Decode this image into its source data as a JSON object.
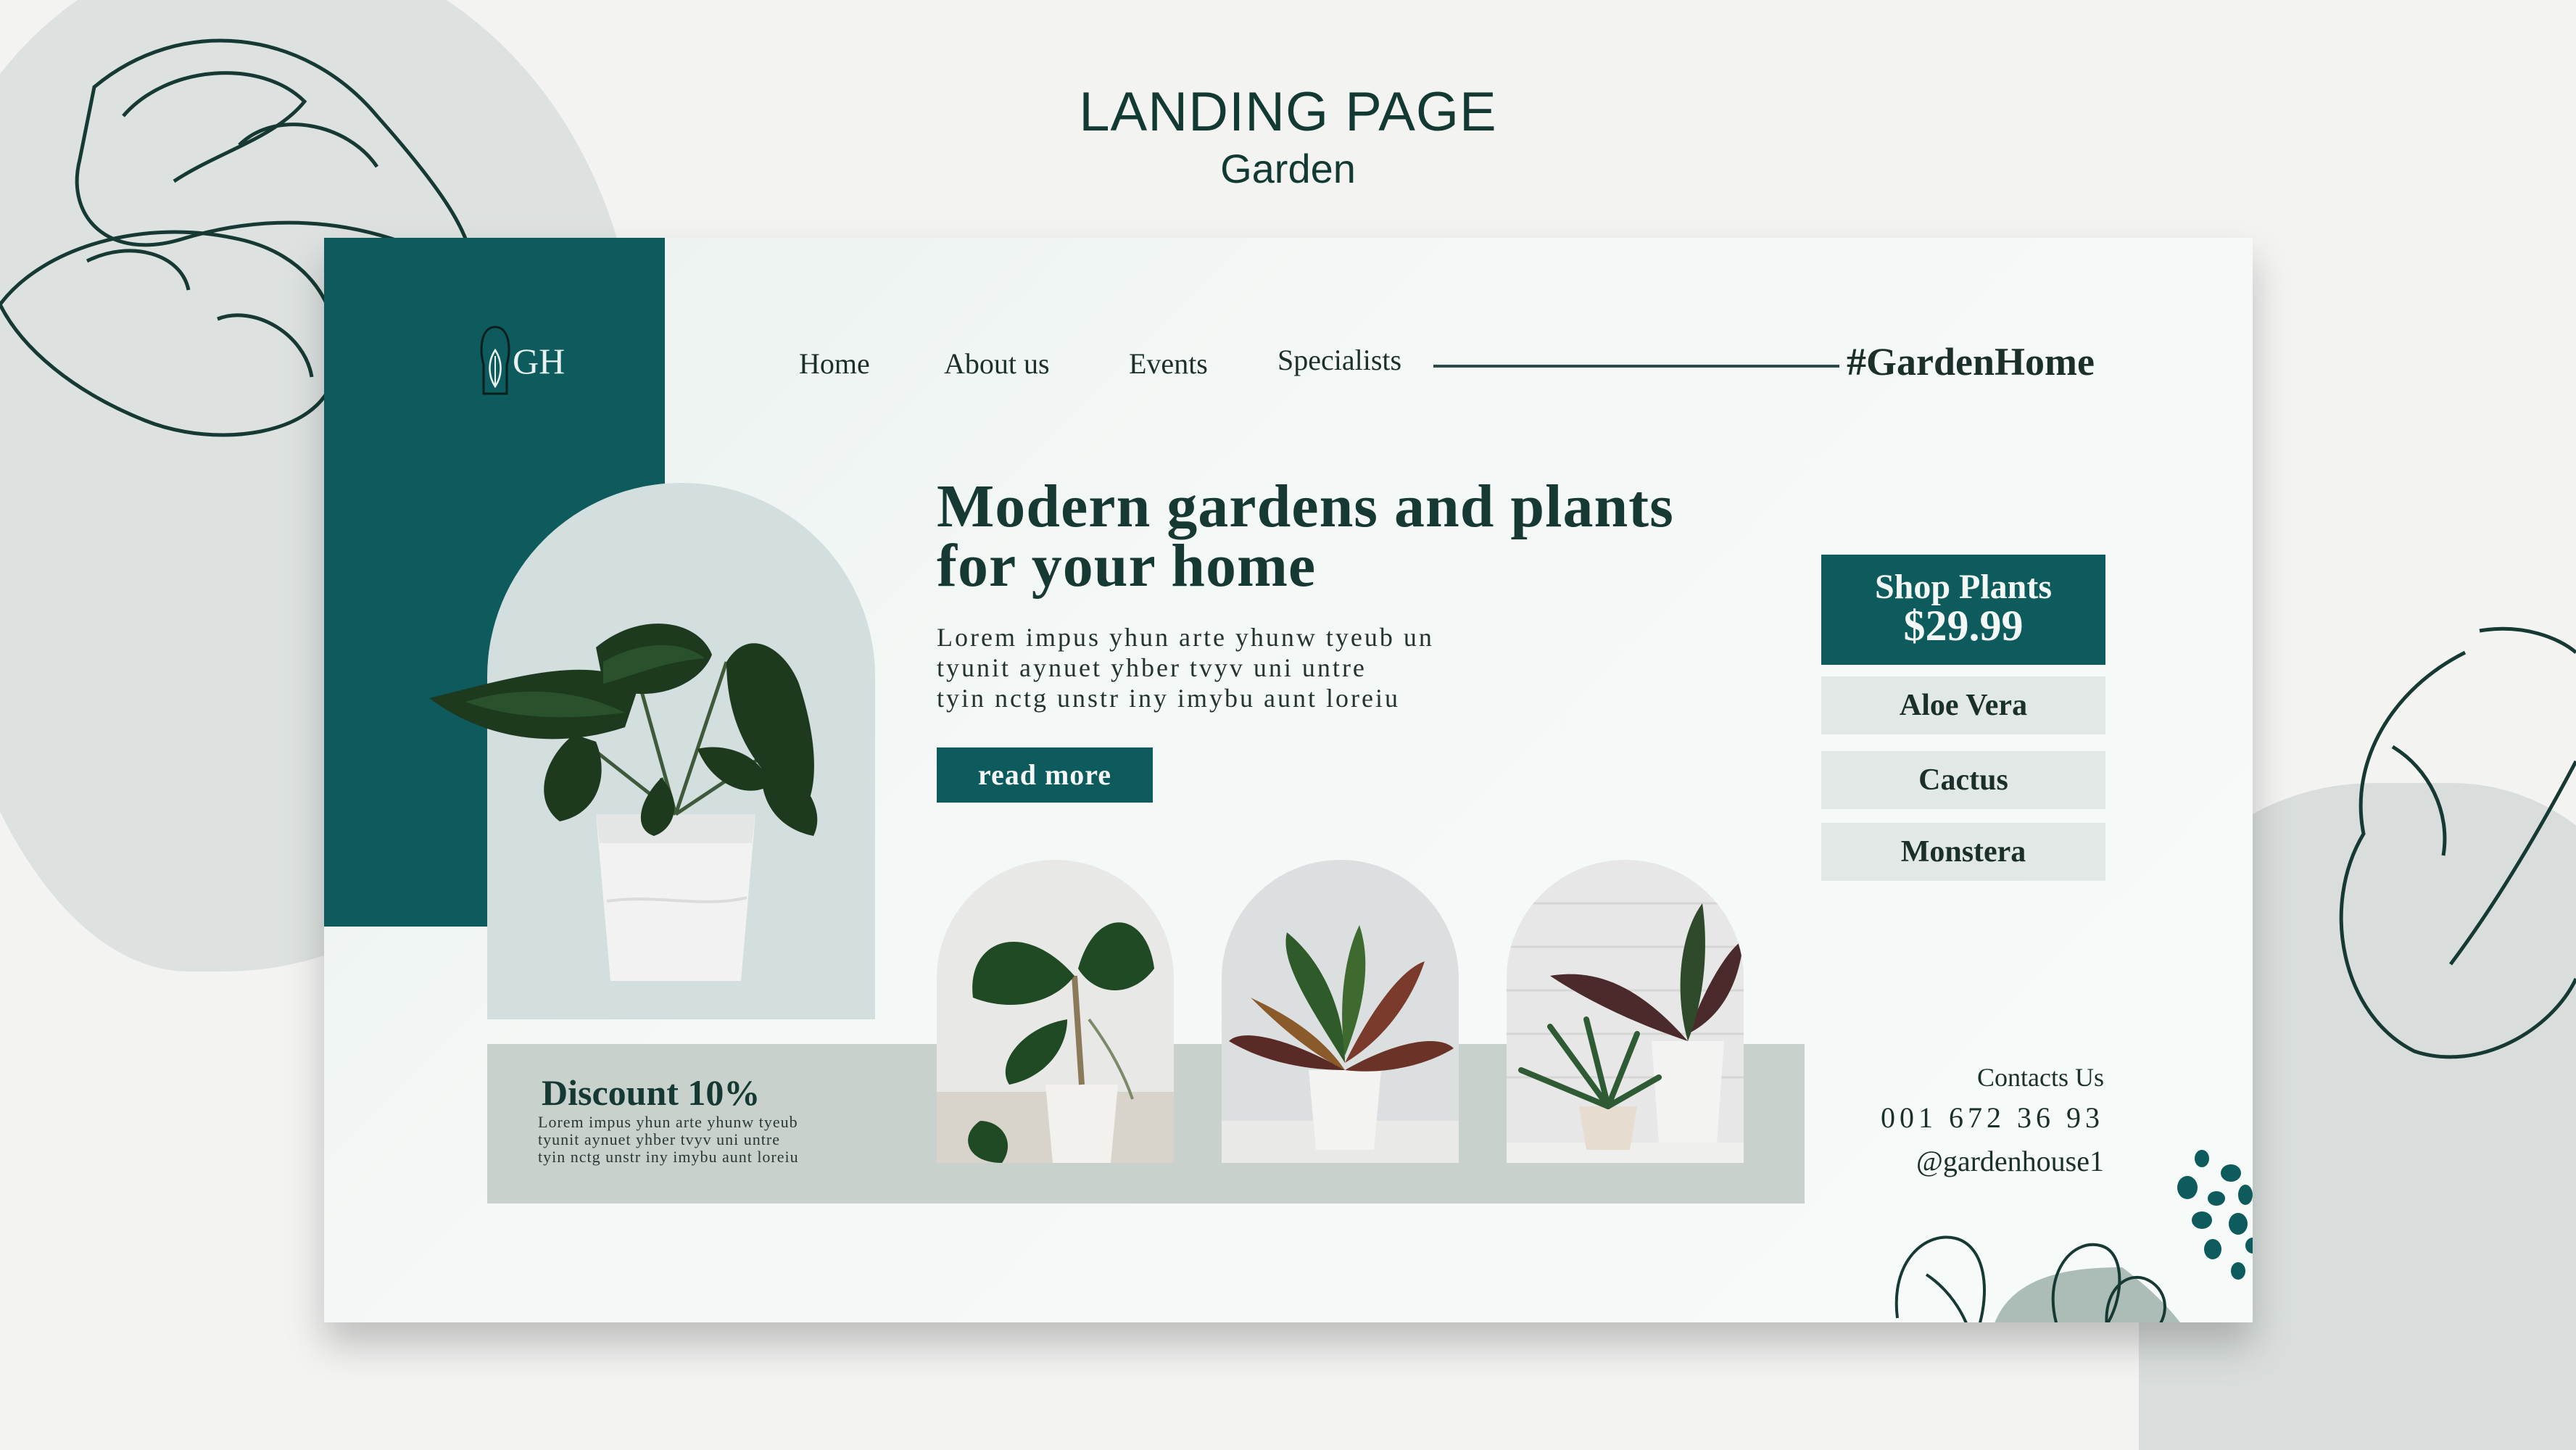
{
  "header": {
    "title": "LANDING PAGE",
    "subtitle": "Garden"
  },
  "logo": {
    "text": "GH"
  },
  "nav": {
    "items": [
      {
        "label": "Home"
      },
      {
        "label": "About us"
      },
      {
        "label": "Events"
      },
      {
        "label": "Specialists"
      }
    ],
    "hashtag": "#GardenHome"
  },
  "hero": {
    "title_lines": [
      "Modern gardens and plants",
      "for your home"
    ],
    "body_lines": [
      "Lorem impus yhun arte yhunw tyeub un",
      "tyunit aynuet yhber tvyv uni untre",
      "tyin nctg unstr iny imybu aunt loreiu"
    ],
    "cta_label": "read more"
  },
  "discount": {
    "title": "Discount 10%",
    "body_lines": [
      "Lorem impus yhun arte yhunw tyeub",
      "tyunit aynuet yhber tvyv uni untre",
      "tyin nctg unstr iny imybu aunt loreiu"
    ]
  },
  "shop": {
    "label": "Shop Plants",
    "price": "$29.99",
    "plants": [
      {
        "label": "Aloe Vera"
      },
      {
        "label": "Cactus"
      },
      {
        "label": "Monstera"
      }
    ]
  },
  "contacts": {
    "title": "Contacts Us",
    "phone": "001 672 36 93",
    "handle": "@gardenhouse1"
  },
  "colors": {
    "brand_teal": "#0d5b5d",
    "dark_text": "#163a33",
    "band": "#c8d1cc",
    "button_light": "#e2e8e5"
  },
  "icons": [
    "leaf-logo-icon",
    "monstera-leaf-outline-icon",
    "dots-decoration-icon"
  ]
}
